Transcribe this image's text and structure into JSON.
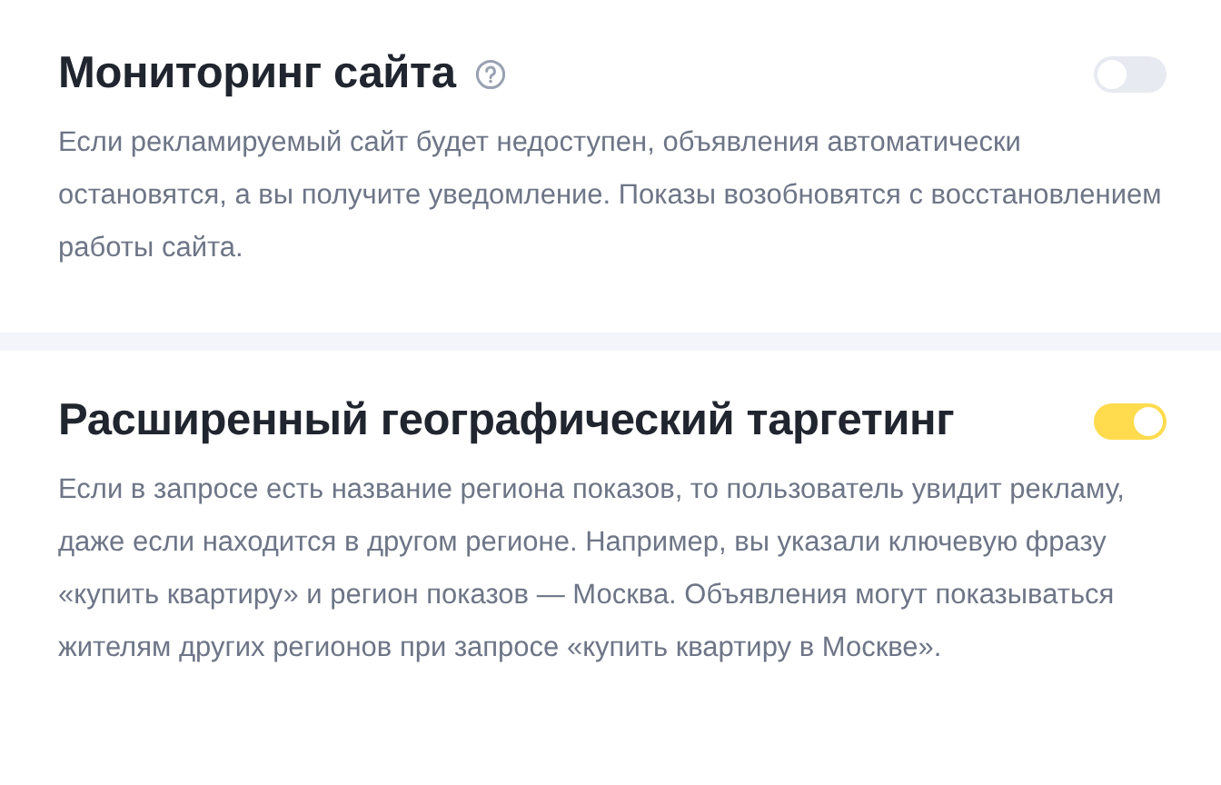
{
  "sections": [
    {
      "title": "Мониторинг сайта",
      "help": true,
      "on": false,
      "description": "Если рекламируемый сайт будет недоступен, объявления автоматически остановятся, а вы получите уведомление. Показы возобновятся с восстановлением работы сайта."
    },
    {
      "title": "Расширенный географический таргетинг",
      "help": false,
      "on": true,
      "description": "Если в запросе есть название региона показов, то пользователь увидит рекламу, даже если находится в другом регионе. Например, вы указали ключевую фразу «купить квартиру» и регион показов — Москва. Объявления могут показываться жителям других регионов при запросе «купить квартиру в Москве»."
    }
  ]
}
